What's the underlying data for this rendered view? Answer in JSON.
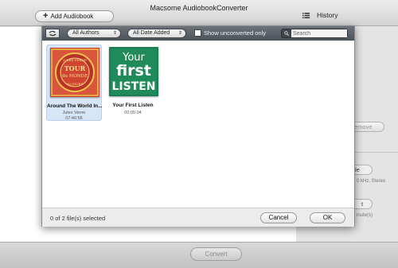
{
  "window": {
    "title": "Macsome AudiobookConverter",
    "add_audiobook_label": "Add Audiobook",
    "history_label": "History"
  },
  "right_panel": {
    "remove_label": "emove",
    "button1_label": "le",
    "info1": "0 kHz, Stereo",
    "button2_label": "t",
    "info2": "inute(s)"
  },
  "bottom": {
    "convert_label": "Convert"
  },
  "dialog": {
    "authors_filter": "All Authors",
    "date_filter": "All Date Added",
    "show_unconverted_label": "Show unconverted only",
    "show_unconverted_checked": false,
    "search_placeholder": "Search",
    "selected_count": "0 of 2 file(s) selected",
    "cancel_label": "Cancel",
    "ok_label": "OK",
    "books": [
      {
        "title": "Around The World In...",
        "author": "Jules Verne",
        "duration": "07:46:56",
        "selected": true,
        "cover_lines": [
          "JULES VERNE",
          "TOUR",
          "du MONDE",
          "80 JOURS"
        ]
      },
      {
        "title": "Your First Listen",
        "author": "",
        "duration": "00:05:04",
        "selected": false,
        "cover_lines": [
          "Your",
          "first",
          "LISTEN"
        ]
      }
    ]
  },
  "colors": {
    "toolbar_dark": "#4b525a",
    "selection": "#d6e6f7",
    "cover2_green": "#1f8a5a"
  }
}
